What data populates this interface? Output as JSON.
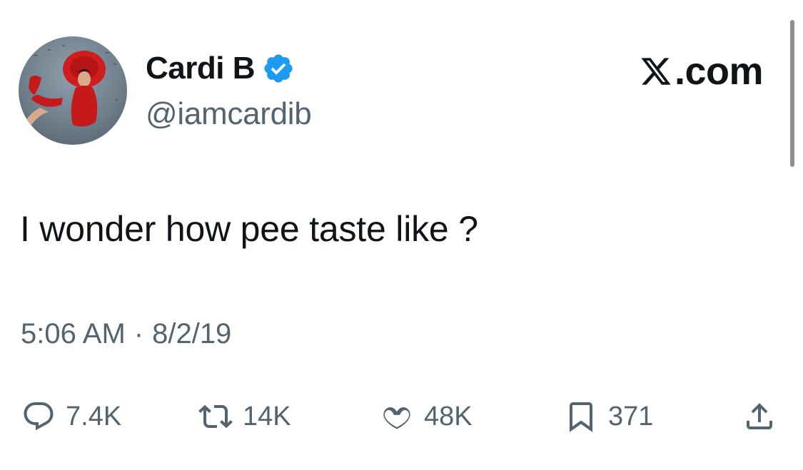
{
  "author": {
    "display_name": "Cardi B",
    "handle": "@iamcardib",
    "verified": true,
    "verified_color": "#1d9bf0",
    "avatar_icon": "profile-photo"
  },
  "brand": {
    "text": ".com",
    "logo_icon": "x-logo-icon"
  },
  "tweet": {
    "text": "I wonder how pee taste like ?",
    "time": "5:06 AM",
    "separator": "·",
    "date": "8/2/19"
  },
  "actions": {
    "replies": "7.4K",
    "reposts": "14K",
    "likes": "48K",
    "bookmarks": "371"
  },
  "colors": {
    "text_primary": "#0f1419",
    "text_secondary": "#536471",
    "background": "#ffffff"
  }
}
